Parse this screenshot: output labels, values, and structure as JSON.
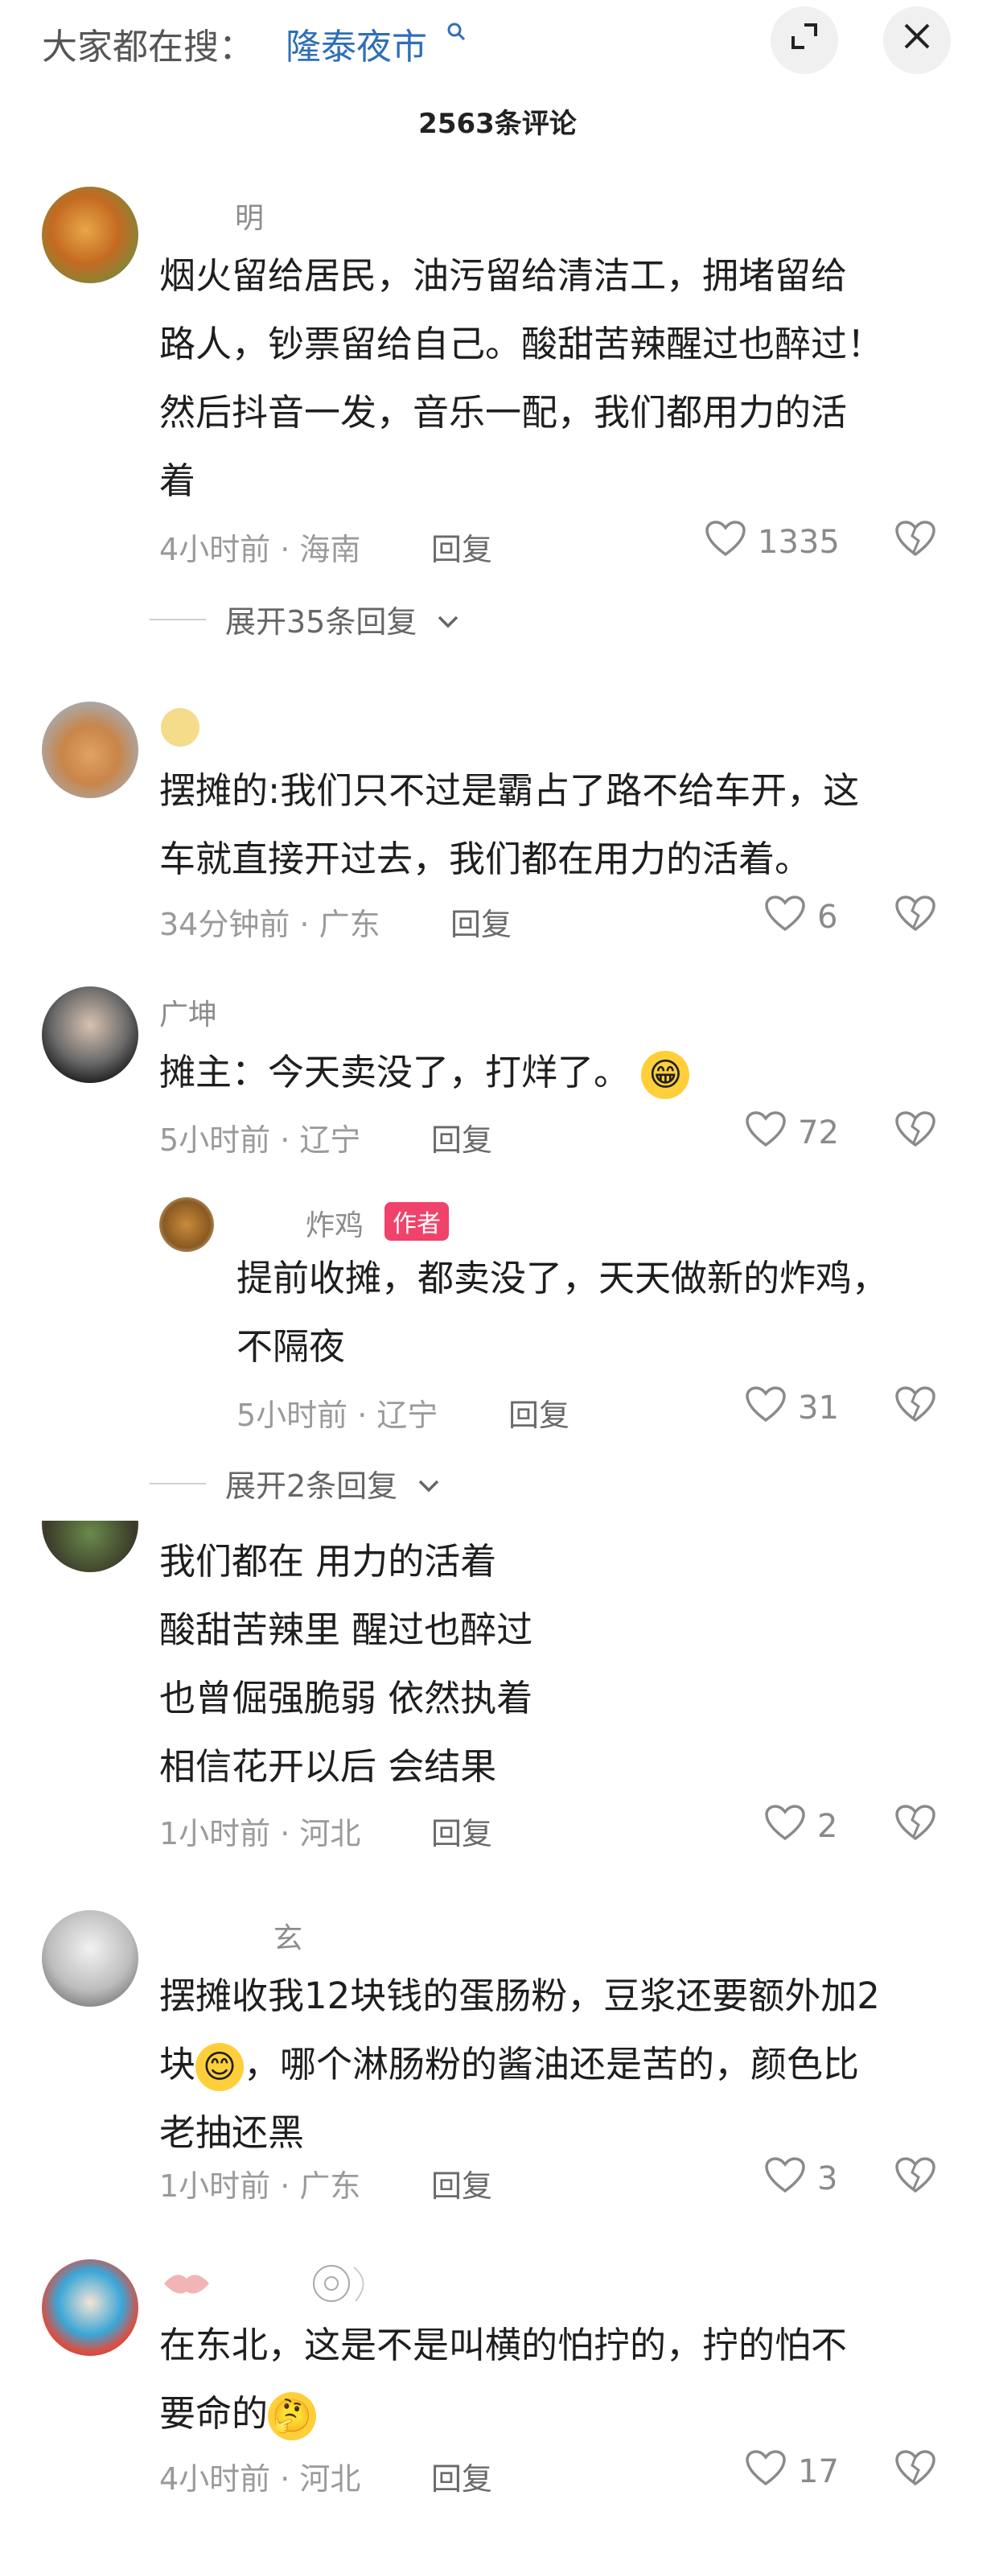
{
  "header": {
    "search_label": "大家都在搜：",
    "search_keyword": "隆泰夜市",
    "expand_icon": "⤢",
    "close_icon": "✕"
  },
  "comment_count": "2563条评论",
  "comments": [
    {
      "username": "明",
      "lines": [
        "烟火留给居民，油污留给清洁工，拥堵留给",
        "路人，钞票留给自己。酸甜苦辣醒过也醉过！",
        "然后抖音一发，音乐一配，我们都用力的活",
        "着"
      ],
      "meta": "4小时前 · 海南",
      "reply": "回复",
      "likes": "1335",
      "expand": "展开35条回复"
    },
    {
      "username": "",
      "lines": [
        "摆摊的:我们只不过是霸占了路不给车开，这",
        "车就直接开过去，我们都在用力的活着。"
      ],
      "meta": "34分钟前 · 广东",
      "reply": "回复",
      "likes": "6"
    },
    {
      "username": "广坤",
      "lines": [
        "摊主：今天卖没了，打烊了。"
      ],
      "meta": "5小时前 · 辽宁",
      "reply": "回复",
      "likes": "72",
      "sub_reply": {
        "username": "炸鸡",
        "badge": "作者",
        "lines": [
          "提前收摊，都卖没了，天天做新的炸鸡，",
          "不隔夜"
        ],
        "meta": "5小时前 · 辽宁",
        "reply": "回复",
        "likes": "31"
      },
      "expand": "展开2条回复"
    },
    {
      "username": "",
      "lines": [
        "我们都在 用力的活着",
        "酸甜苦辣里 醒过也醉过",
        "也曾倔强脆弱 依然执着",
        "相信花开以后 会结果"
      ],
      "meta": "1小时前 · 河北",
      "reply": "回复",
      "likes": "2"
    },
    {
      "username": "玄",
      "lines": [
        "摆摊收我12块钱的蛋肠粉，豆浆还要额外加2",
        "块",
        "，哪个淋肠粉的酱油还是苦的，颜色比",
        "老抽还黑"
      ],
      "meta": "1小时前 · 广东",
      "reply": "回复",
      "likes": "3"
    },
    {
      "username": "",
      "lines": [
        "在东北，这是不是叫横的怕拧的，拧的怕不",
        "要命的"
      ],
      "meta": "4小时前 · 河北",
      "reply": "回复",
      "likes": "17"
    }
  ]
}
